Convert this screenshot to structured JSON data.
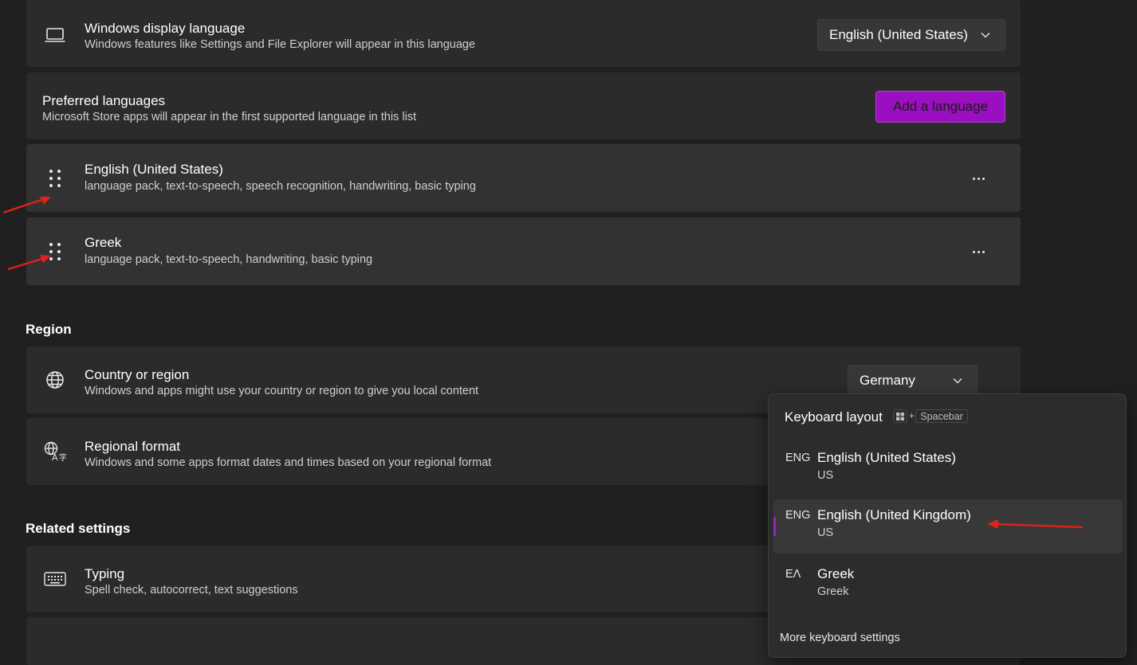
{
  "display_language": {
    "title": "Windows display language",
    "description": "Windows features like Settings and File Explorer will appear in this language",
    "selected": "English (United States)",
    "icon": "laptop-icon"
  },
  "preferred_languages": {
    "title": "Preferred languages",
    "description": "Microsoft Store apps will appear in the first supported language in this list",
    "add_button": "Add a language",
    "items": [
      {
        "name": "English (United States)",
        "features": "language pack, text-to-speech, speech recognition, handwriting, basic typing"
      },
      {
        "name": "Greek",
        "features": "language pack, text-to-speech, handwriting, basic typing"
      }
    ]
  },
  "region": {
    "heading": "Region",
    "country": {
      "title": "Country or region",
      "description": "Windows and apps might use your country or region to give you local content",
      "selected": "Germany"
    },
    "format": {
      "title": "Regional format",
      "description": "Windows and some apps format dates and times based on your regional format"
    }
  },
  "related": {
    "heading": "Related settings",
    "typing": {
      "title": "Typing",
      "description": "Spell check, autocorrect, text suggestions"
    }
  },
  "keyboard_flyout": {
    "title": "Keyboard layout",
    "shortcut_plus": "+",
    "shortcut_key": "Spacebar",
    "items": [
      {
        "abbr": "ENG",
        "name": "English (United States)",
        "layout": "US",
        "selected": false
      },
      {
        "abbr": "ENG",
        "name": "English (United Kingdom)",
        "layout": "US",
        "selected": true
      },
      {
        "abbr": "ΕΛ",
        "name": "Greek",
        "layout": "Greek",
        "selected": false
      }
    ],
    "more_link": "More keyboard settings"
  },
  "colors": {
    "accent": "#9a0fbf",
    "annotation_arrow": "#e0201a"
  }
}
